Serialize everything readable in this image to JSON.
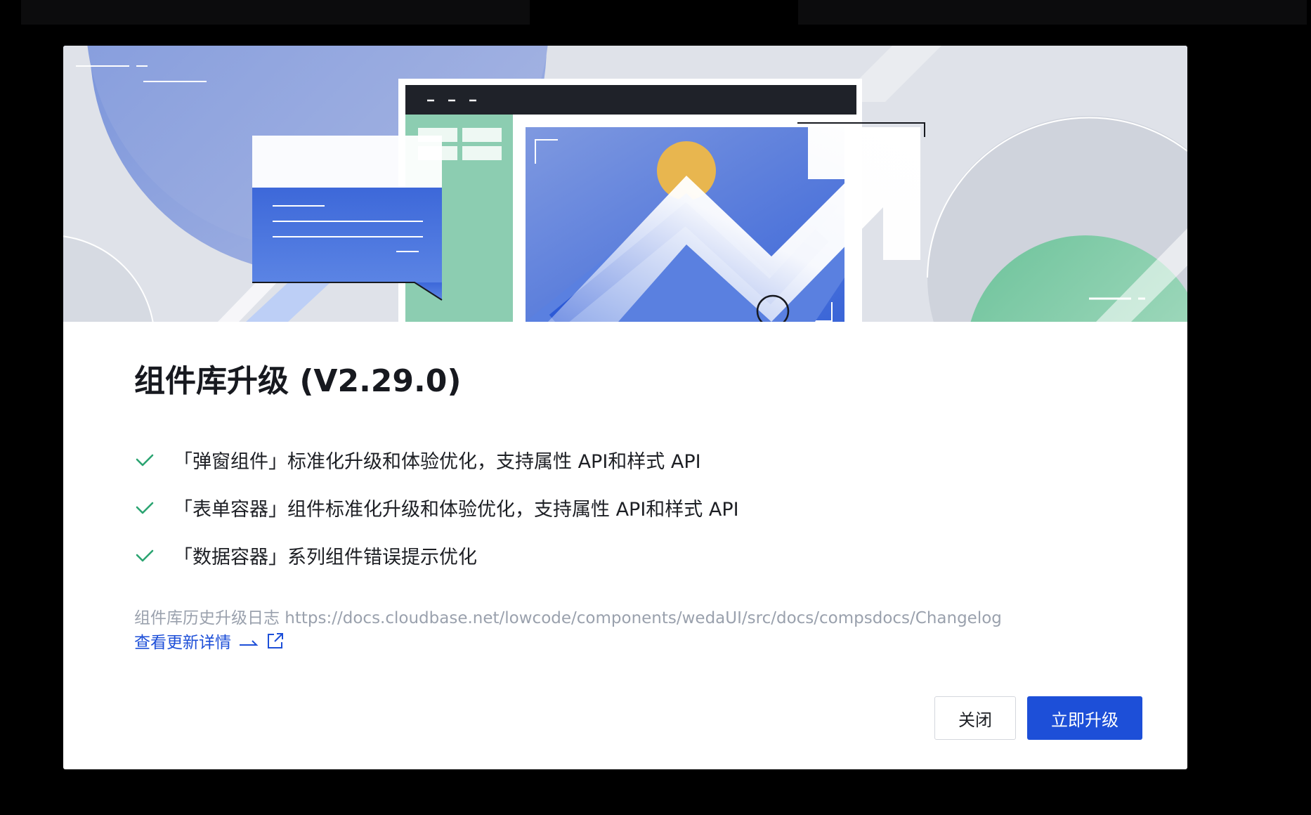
{
  "modal": {
    "title": "组件库升级 (V2.29.0)",
    "features": [
      "「弹窗组件」标准化升级和体验优化，支持属性 API和样式 API",
      "「表单容器」组件标准化升级和体验优化，支持属性 API和样式 API",
      "「数据容器」系列组件错误提示优化"
    ],
    "changelog_text": "组件库历史升级日志 https://docs.cloudbase.net/lowcode/components/wedaUI/src/docs/compsdocs/Changelog",
    "detail_link_label": "查看更新详情",
    "close_label": "关闭",
    "upgrade_label": "立即升级"
  },
  "colors": {
    "primary": "#1d4fd8",
    "check": "#2ba471",
    "muted_text": "#9aa1ad",
    "title_text": "#17191f"
  },
  "icons": {
    "feature": "check-icon",
    "link_arrow": "arrow-right-icon",
    "link_external": "external-link-icon"
  }
}
